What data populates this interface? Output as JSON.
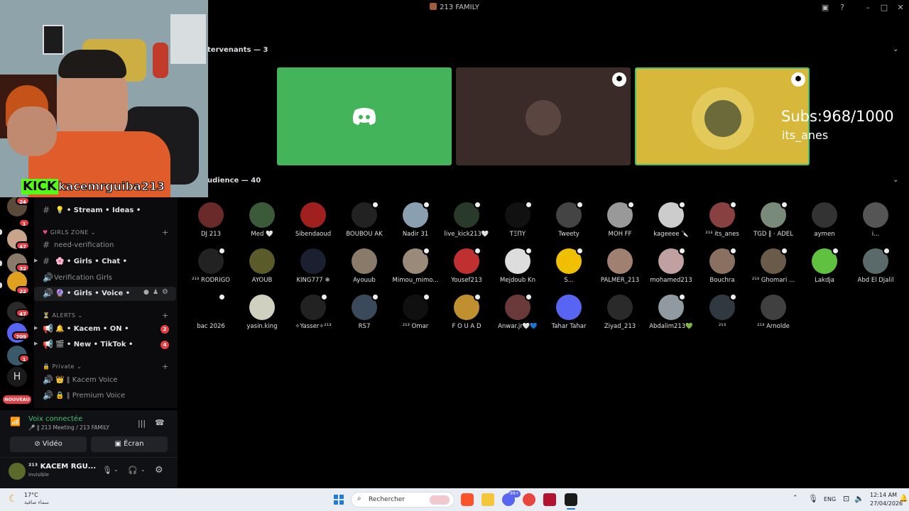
{
  "window": {
    "title": "213 FAMILY"
  },
  "stream_overlay": {
    "kick_logo_text": "KICK",
    "kick_username": "kacemrguiba213",
    "subs": "Subs:968/1000",
    "latest_sub": "its_anes"
  },
  "stage": {
    "speakers_header": "tervenants — 3",
    "audience_header": "udience — 40"
  },
  "servers": {
    "badges": [
      "24",
      "1",
      "47",
      "32",
      "22",
      "47",
      "709",
      "1"
    ],
    "new_label": "NOUVEAU"
  },
  "channels": {
    "items": [
      {
        "label": "💡 • Stream • Ideas •",
        "kind": "#"
      },
      {
        "label": "GIRLS ZONE",
        "kind": "cat"
      },
      {
        "label": "need-verification",
        "kind": "#"
      },
      {
        "label": "🌸 • Girls • Chat •",
        "kind": "#"
      },
      {
        "label": "Verification Girls",
        "kind": "voice"
      },
      {
        "label": "🔮 • Girls • Voice •",
        "kind": "voice"
      },
      {
        "label": "ALERTS",
        "kind": "cat"
      },
      {
        "label": "🔔 • Kacem • ON •",
        "kind": "voice",
        "badge": "2"
      },
      {
        "label": "🎬 • New • TikTok •",
        "kind": "voice",
        "badge": "4"
      },
      {
        "label": "Private",
        "kind": "cat"
      },
      {
        "label": "👑 ‖ Kacem Voice",
        "kind": "voice"
      },
      {
        "label": "🔒 ‖ Premium Voice",
        "kind": "voice"
      }
    ]
  },
  "voice": {
    "status": "Voix connectée",
    "channel": "🎤 ‖ 213 Meeting / 213 FAMILY",
    "video_label": "Vidéo",
    "screen_label": "Écran"
  },
  "user": {
    "name": "²¹³ KACEM RGU...",
    "status": "Invisible"
  },
  "audience": [
    "DJ 213",
    "Med 🤍",
    "Sibendaoud",
    "BOUBOU AK",
    "Nadir 31",
    "live_kick213🤍",
    "ƬΞПY",
    "Tweety",
    "MÔH FF",
    "kageeee 🔪",
    "²¹³ its_anes",
    "TGD ‖ · ADEL",
    "aymen",
    "i...",
    "²¹³ RODRIGO",
    "AYOUB",
    "KING777 ❄",
    "Ayouub",
    "Mimou_mimo...",
    "Yousef213",
    "Mejdoub Kn",
    "S...",
    "PALMER_213",
    "mohamed213",
    "Bouchra",
    "²¹³ Ghomari ...",
    "Lakdja",
    "Abd El Djalil",
    "bac 2026",
    "yasin.king",
    "✧Yasser✧²¹³",
    "RS7",
    "²¹³ Omar",
    "F O U A D",
    "Anwar.jr🤍💙",
    "Tahar Tahar",
    "Ziyad_213",
    "Abdalim213💚",
    "²¹³",
    "²¹³ Arnolde"
  ],
  "taskbar": {
    "weather_temp": "17°C",
    "weather_desc": "سماء صافية",
    "search_placeholder": "Rechercher",
    "lang": "ENG",
    "time": "12:14 AM",
    "date": "27/04/2026",
    "discord_badge": "99+"
  },
  "colors": {
    "stage_green": "#43b45a",
    "stage_brown": "#3a2a28",
    "stage_yellow": "#d8b83a",
    "badge_red": "#e33f44",
    "connected_green": "#45c06f"
  }
}
